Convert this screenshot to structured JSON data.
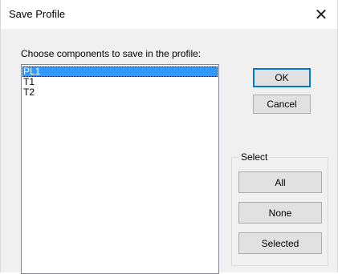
{
  "window": {
    "title": "Save Profile",
    "close_glyph": "✕"
  },
  "prompt": "Choose components to save in the profile:",
  "components": {
    "items": [
      "PL1",
      "T1",
      "T2"
    ],
    "selected": "PL1"
  },
  "buttons": {
    "ok": "OK",
    "cancel": "Cancel"
  },
  "select_group": {
    "legend": "Select",
    "all": "All",
    "none": "None",
    "selected": "Selected"
  },
  "colors": {
    "selection": "#3399ff",
    "default_button_border": "#0078d7"
  }
}
